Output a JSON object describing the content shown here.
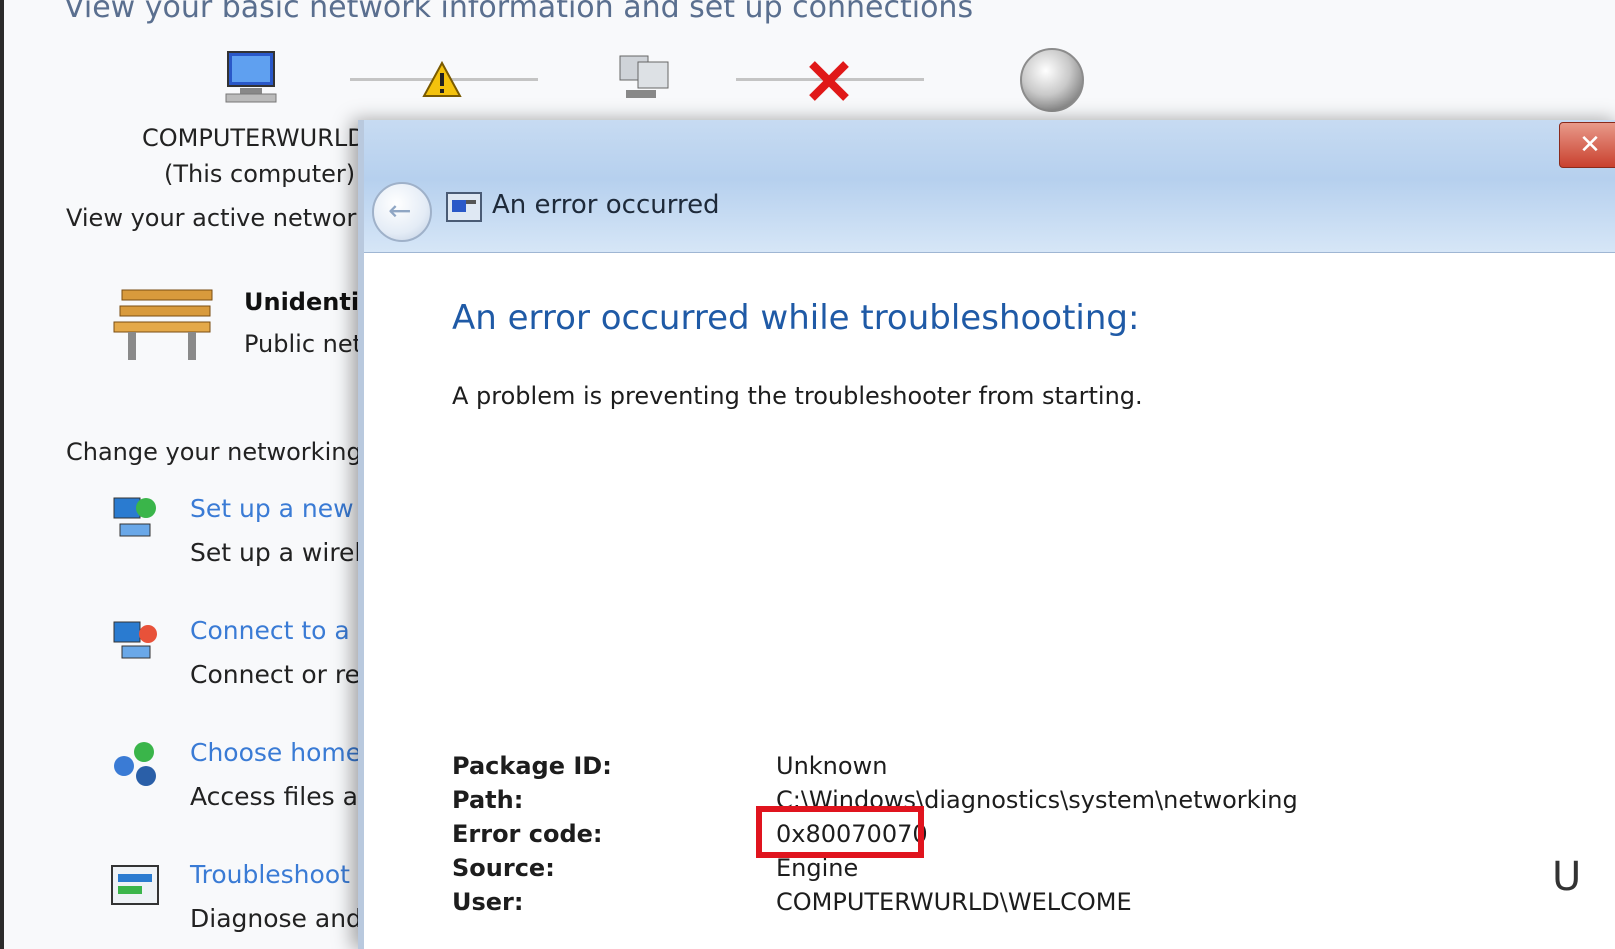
{
  "background": {
    "header": "View your basic network information and set up connections",
    "computer_name": "COMPUTERWURLD",
    "computer_sub": "(This computer)",
    "active_networks_label": "View your active networks",
    "network": {
      "name": "Unidentified network",
      "type": "Public network"
    },
    "change_label": "Change your networking settings",
    "tasks": [
      {
        "link": "Set up a new connection or network",
        "desc": "Set up a wireless, broadband, dial-up"
      },
      {
        "link": "Connect to a network",
        "desc": "Connect or reconnect to a wireless"
      },
      {
        "link": "Choose homegroup and sharing options",
        "desc": "Access files and printers"
      },
      {
        "link": "Troubleshoot problems",
        "desc": "Diagnose and repair"
      }
    ]
  },
  "dialog": {
    "title": "An error occurred",
    "close_label": "✕",
    "heading": "An error occurred while troubleshooting:",
    "message": "A problem is preventing the troubleshooter from starting.",
    "details": {
      "package_id_label": "Package ID:",
      "package_id": "Unknown",
      "path_label": "Path:",
      "path": "C:\\Windows\\diagnostics\\system\\networking",
      "error_code_label": "Error code:",
      "error_code": "0x80070070",
      "source_label": "Source:",
      "source": "Engine",
      "user_label": "User:",
      "user": "COMPUTERWURLD\\WELCOME"
    }
  },
  "colors": {
    "highlight": "#e0141e",
    "link": "#3a7bd5",
    "heading": "#1f5aa6"
  },
  "edge_glyph": "U"
}
